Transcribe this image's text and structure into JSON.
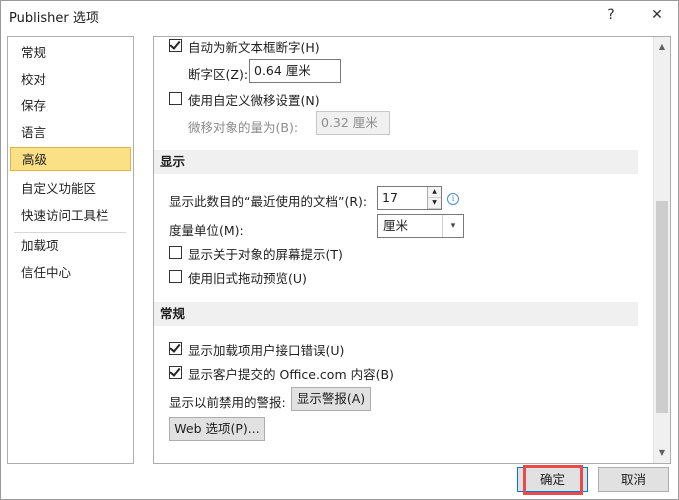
{
  "window": {
    "title": "Publisher 选项",
    "help_glyph": "?",
    "close_glyph": "✕"
  },
  "nav": {
    "items": [
      {
        "label": "常规"
      },
      {
        "label": "校对"
      },
      {
        "label": "保存"
      },
      {
        "label": "语言"
      },
      {
        "label": "高级",
        "selected": true
      },
      {
        "label": "自定义功能区"
      },
      {
        "label": "快速访问工具栏"
      },
      {
        "label": "加载项"
      },
      {
        "label": "信任中心"
      }
    ]
  },
  "editing": {
    "auto_hyphenate": {
      "label": "自动为新文本框断字(H)",
      "checked": true
    },
    "hyphen_zone": {
      "label": "断字区(Z):",
      "value": "0.64 厘米"
    },
    "custom_nudge": {
      "label": "使用自定义微移设置(N)",
      "checked": false
    },
    "nudge_amount": {
      "label": "微移对象的量为(B):",
      "value": "0.32 厘米"
    }
  },
  "display": {
    "header": "显示",
    "recent_docs": {
      "label": "显示此数目的“最近使用的文档”(R):",
      "value": "17"
    },
    "unit": {
      "label": "度量单位(M):",
      "value": "厘米"
    },
    "screentips": {
      "label": "显示关于对象的屏幕提示(T)",
      "checked": false
    },
    "old_drag": {
      "label": "使用旧式拖动预览(U)",
      "checked": false
    }
  },
  "general": {
    "header": "常规",
    "addin_errors": {
      "label": "显示加载项用户接口错误(U)",
      "checked": true
    },
    "office_content": {
      "label": "显示客户提交的 Office.com 内容(B)",
      "checked": true
    },
    "disabled_alerts_label": "显示以前禁用的警报:",
    "show_alerts_button": "显示警报(A)",
    "web_options_button": "Web 选项(P)..."
  },
  "footer": {
    "ok": "确定",
    "cancel": "取消"
  },
  "icons": {
    "info": "i",
    "spin_up": "▲",
    "spin_down": "▼",
    "dropdown": "▾",
    "scroll_up": "▲",
    "scroll_down": "▼"
  },
  "colors": {
    "nav_selected_bg": "#fbe085",
    "section_header_bg": "#f0f0f0",
    "ok_border": "#0078d7",
    "annotation_red": "#e84b4b"
  }
}
